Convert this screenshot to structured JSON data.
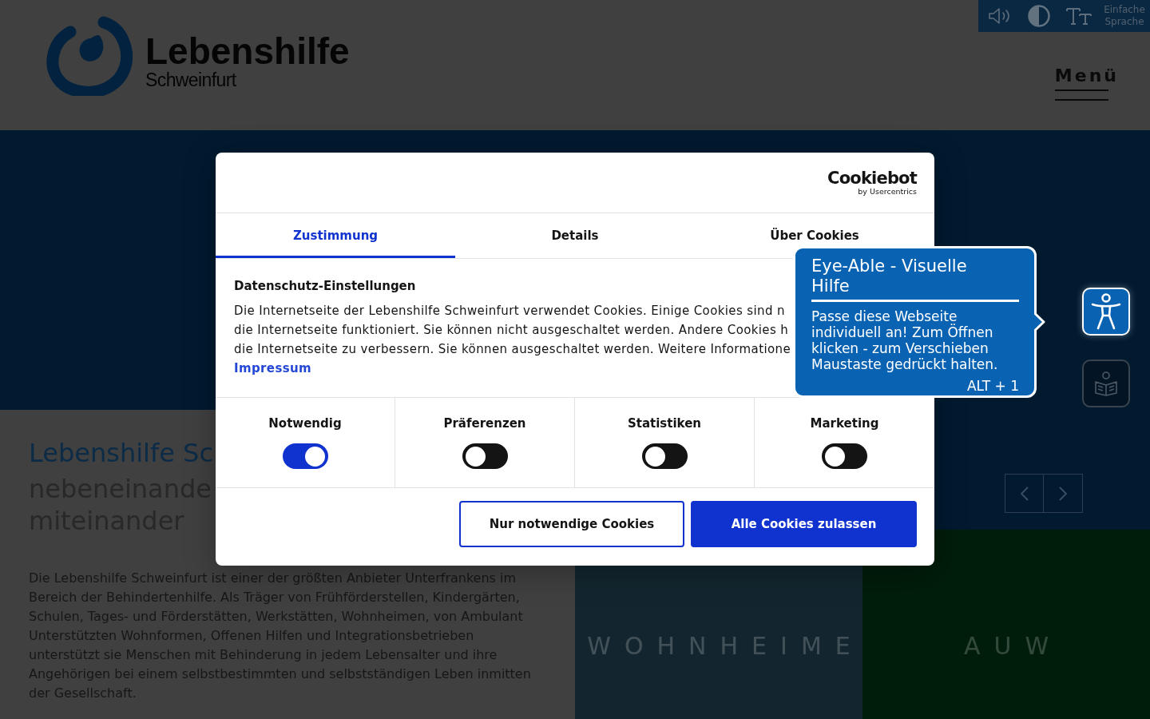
{
  "header": {
    "logo": {
      "name": "Lebenshilfe",
      "place": "Schweinfurt"
    },
    "toolbar": {
      "simple_language": "Einfache Sprache"
    },
    "menu": "Menü"
  },
  "intro": {
    "heading": "Lebenshilfe Sc",
    "subheading_lines": [
      "nebeneinande",
      "miteinander"
    ],
    "paragraph": "Die Lebenshilfe Schweinfurt ist einer der größten Anbieter Unterfrankens im Bereich der Behindertenhilfe. Als Träger von Frühförderstellen, Kindergärten, Schulen, Tages- und Förderstätten, Werkstätten, Wohnheimen, von Ambulant Unterstützten Wohnformen, Offenen Hilfen und Integrationsbetrieben unterstützt sie Menschen mit Behinderung in jedem Lebensalter und ihre Angehörigen bei einem selbstbestimmten und selbstständigen Leben inmitten der Gesellschaft."
  },
  "tiles": [
    {
      "label": "WOHNHEIME",
      "color": "#13262f"
    },
    {
      "label": "AUW",
      "color": "#001d0b"
    }
  ],
  "cookie_dialog": {
    "brand": {
      "name": "Cookiebot",
      "byline": "by Usercentrics"
    },
    "tabs": [
      {
        "label": "Zustimmung",
        "selected": true
      },
      {
        "label": "Details",
        "selected": false
      },
      {
        "label": "Über Cookies",
        "selected": false
      }
    ],
    "heading": "Datenschutz-Einstellungen",
    "text_lines": [
      "Die Internetseite der Lebenshilfe Schweinfurt verwendet Cookies. Einige Cookies sind n",
      "die Internetseite funktioniert. Sie können nicht ausgeschaltet werden. Andere Cookies h",
      "die Internetseite zu verbessern. Sie können ausgeschaltet werden. Weitere Informatione"
    ],
    "link": "Impressum",
    "categories": [
      {
        "label": "Notwendig",
        "checked": true
      },
      {
        "label": "Präferenzen",
        "checked": false
      },
      {
        "label": "Statistiken",
        "checked": false
      },
      {
        "label": "Marketing",
        "checked": false
      }
    ],
    "buttons": [
      {
        "label": "Nur notwendige Cookies",
        "kind": "outline"
      },
      {
        "label": "Alle Cookies zulassen",
        "kind": "primary"
      }
    ]
  },
  "eye_able": {
    "title": "Eye-Able - Visuelle Hilfe",
    "text": "Passe diese Webseite individuell an! Zum Öffnen klicken - zum Verschieben Maustaste gedrückt halten.",
    "shortcut": "ALT + 1"
  }
}
